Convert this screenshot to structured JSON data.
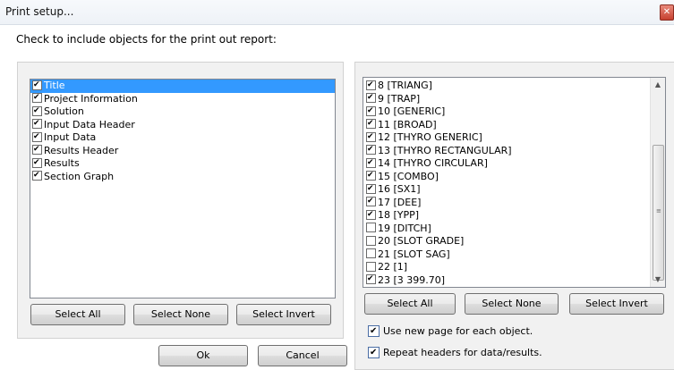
{
  "window": {
    "title": "Print setup...",
    "close_icon": "close-icon"
  },
  "instruction": "Check to include objects for the print out report:",
  "left_list": {
    "items": [
      {
        "label": "Title",
        "checked": true,
        "selected": true
      },
      {
        "label": "Project Information",
        "checked": true,
        "selected": false
      },
      {
        "label": "Solution",
        "checked": true,
        "selected": false
      },
      {
        "label": "Input Data Header",
        "checked": true,
        "selected": false
      },
      {
        "label": "Input Data",
        "checked": true,
        "selected": false
      },
      {
        "label": "Results Header",
        "checked": true,
        "selected": false
      },
      {
        "label": "Results",
        "checked": true,
        "selected": false
      },
      {
        "label": "Section Graph",
        "checked": true,
        "selected": false
      }
    ],
    "select_all": "Select All",
    "select_none": "Select None",
    "select_invert": "Select Invert"
  },
  "right_list": {
    "items": [
      {
        "label": "8 [TRIANG]",
        "checked": true
      },
      {
        "label": "9 [TRAP]",
        "checked": true
      },
      {
        "label": "10 [GENERIC]",
        "checked": true
      },
      {
        "label": "11 [BROAD]",
        "checked": true
      },
      {
        "label": "12 [THYRO GENERIC]",
        "checked": true
      },
      {
        "label": "13 [THYRO RECTANGULAR]",
        "checked": true
      },
      {
        "label": "14 [THYRO CIRCULAR]",
        "checked": true
      },
      {
        "label": "15 [COMBO]",
        "checked": true
      },
      {
        "label": "16 [SX1]",
        "checked": true
      },
      {
        "label": "17 [DEE]",
        "checked": true
      },
      {
        "label": "18 [YPP]",
        "checked": true
      },
      {
        "label": "19 [DITCH]",
        "checked": false
      },
      {
        "label": "20 [SLOT GRADE]",
        "checked": false
      },
      {
        "label": "21 [SLOT SAG]",
        "checked": false
      },
      {
        "label": "22 [1]",
        "checked": false
      },
      {
        "label": "23 [3 399.70]",
        "checked": true
      }
    ],
    "select_all": "Select All",
    "select_none": "Select None",
    "select_invert": "Select Invert"
  },
  "options": {
    "new_page": {
      "label": "Use new page for each object.",
      "checked": true
    },
    "repeat_headers": {
      "label": "Repeat headers for data/results.",
      "checked": true
    }
  },
  "buttons": {
    "ok": "Ok",
    "cancel": "Cancel"
  }
}
